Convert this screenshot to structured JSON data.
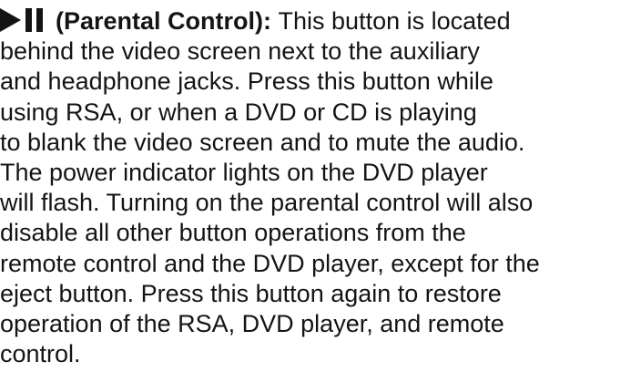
{
  "section": {
    "term": "(Parental Control):",
    "lines": [
      "This button is located",
      "behind the video screen next to the auxiliary",
      "and headphone jacks. Press this button while",
      "using RSA, or when a DVD or CD is playing",
      "to blank the video screen and to mute the audio.",
      "The power indicator lights on the DVD player",
      "will flash. Turning on the parental control will also",
      "disable all other button operations from the",
      "remote control and the DVD player, except for the",
      "eject button. Press this button again to restore",
      "operation of the RSA, DVD player, and remote",
      "control."
    ]
  }
}
